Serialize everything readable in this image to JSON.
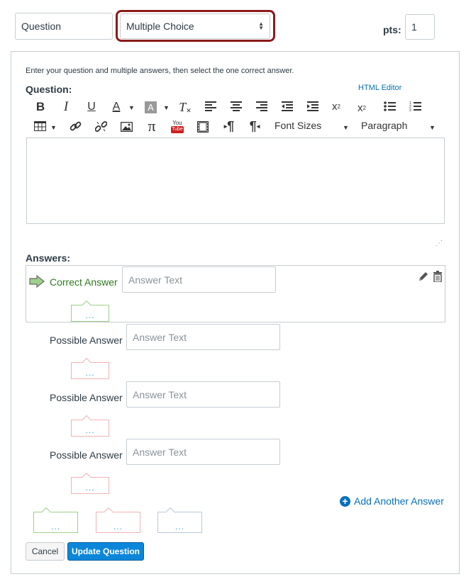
{
  "header": {
    "question_title": "Question",
    "question_type": "Multiple Choice",
    "pts_label": "pts:",
    "pts_value": "1"
  },
  "instructions": "Enter your question and multiple answers, then select the one correct answer.",
  "question_label": "Question:",
  "html_editor_link": "HTML Editor",
  "toolbar": {
    "bold": "B",
    "italic": "I",
    "underline": "U",
    "font_color": "A",
    "bg_color": "A",
    "clear_format": "T",
    "superscript": "x",
    "subscript": "x",
    "pi": "π",
    "youtube_top": "You",
    "youtube_bottom": "Tube",
    "ltr": "¶",
    "rtl": "¶",
    "font_sizes": "Font Sizes",
    "paragraph": "Paragraph"
  },
  "answers_label": "Answers:",
  "correct_answer_label": "Correct Answer",
  "possible_answer_label": "Possible Answer",
  "answer_placeholder": "Answer Text",
  "comment_dots": "...",
  "add_answer_label": "Add Another Answer",
  "buttons": {
    "cancel": "Cancel",
    "update": "Update Question"
  },
  "colors": {
    "highlight": "#8b1a1a",
    "correct": "#2d7a1e",
    "link": "#0770b9",
    "primary_button": "#0b86d9"
  }
}
